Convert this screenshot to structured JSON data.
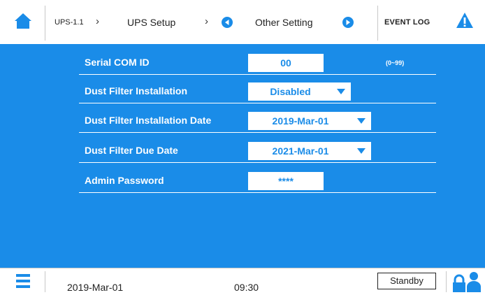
{
  "header": {
    "crumb_id": "UPS-1.1",
    "crumb_setup": "UPS Setup",
    "crumb_page": "Other Setting",
    "event_log": "EVENT LOG"
  },
  "settings": [
    {
      "label": "Serial COM ID",
      "value": "00",
      "type": "input",
      "hint": "(0~99)"
    },
    {
      "label": "Dust Filter Installation",
      "value": "Disabled",
      "type": "select"
    },
    {
      "label": "Dust Filter Installation Date",
      "value": "2019-Mar-01",
      "type": "select"
    },
    {
      "label": "Dust Filter Due Date",
      "value": "2021-Mar-01",
      "type": "select"
    },
    {
      "label": "Admin Password",
      "value": "****",
      "type": "input"
    }
  ],
  "footer": {
    "date": "2019-Mar-01",
    "time": "09:30",
    "status": "Standby"
  },
  "colors": {
    "accent": "#1a8ce8",
    "warning": "#1a8ce8"
  },
  "icons": [
    "home-icon",
    "chevron-right-icon",
    "arrow-left-circle-icon",
    "arrow-right-circle-icon",
    "warning-icon",
    "menu-icon",
    "lock-icon",
    "user-icon"
  ]
}
